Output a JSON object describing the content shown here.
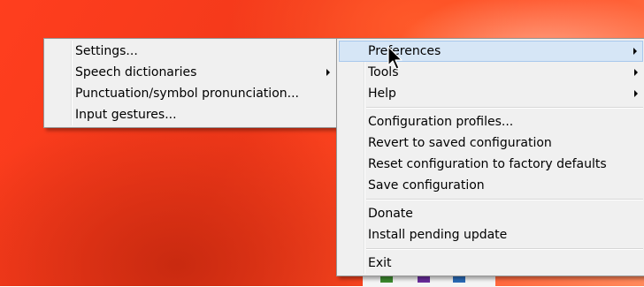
{
  "main_menu": {
    "items": [
      {
        "label": "Preferences",
        "submenu": true,
        "highlighted": true
      },
      {
        "label": "Tools",
        "submenu": true
      },
      {
        "label": "Help",
        "submenu": true
      },
      {
        "label": "Configuration profiles..."
      },
      {
        "label": "Revert to saved configuration"
      },
      {
        "label": "Reset configuration to factory defaults"
      },
      {
        "label": "Save configuration"
      },
      {
        "label": "Donate"
      },
      {
        "label": "Install pending update"
      },
      {
        "label": "Exit"
      }
    ]
  },
  "preferences_submenu": {
    "items": [
      {
        "label": "Settings..."
      },
      {
        "label": "Speech dictionaries",
        "submenu": true
      },
      {
        "label": "Punctuation/symbol pronunciation..."
      },
      {
        "label": "Input gestures..."
      }
    ]
  },
  "colors": {
    "desktop_accent": "#f2391a",
    "menu_background": "#f0f0f0",
    "highlight": "#d6e6f6"
  }
}
